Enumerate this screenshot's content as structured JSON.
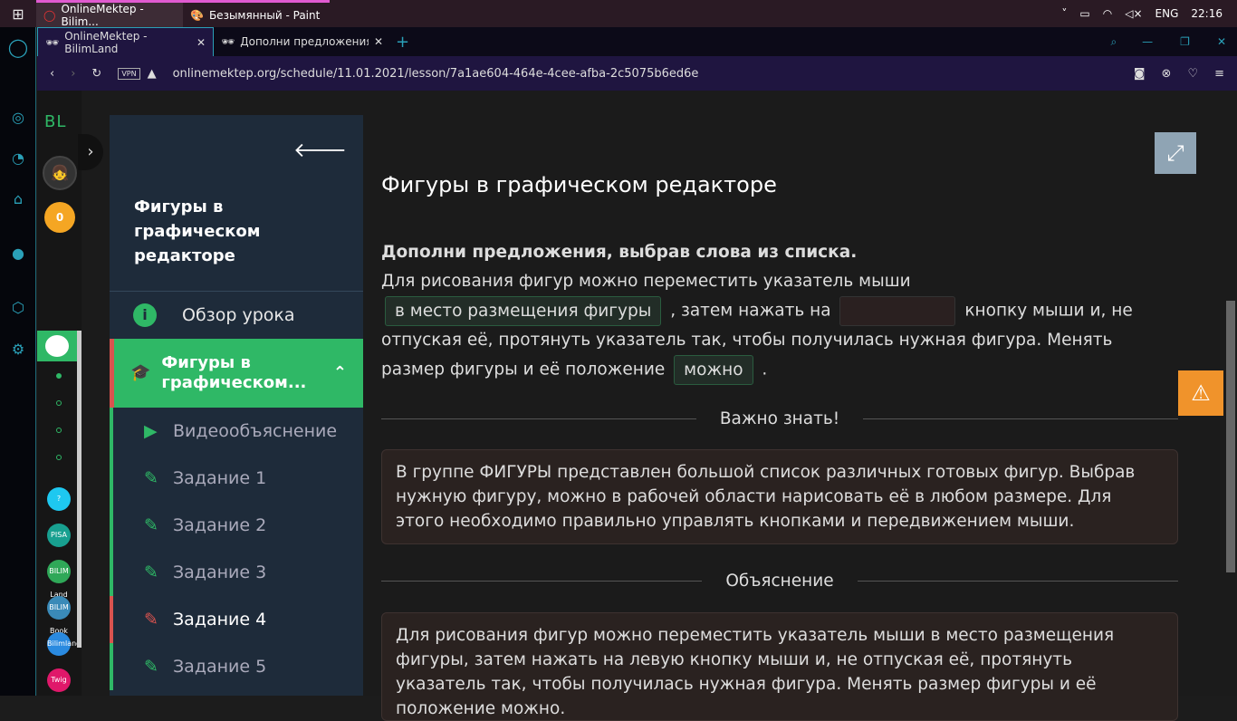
{
  "taskbar": {
    "apps": [
      "OnlineMektep - Bilim...",
      "Безымянный - Paint"
    ],
    "lang": "ENG",
    "time": "22:16"
  },
  "browser": {
    "tabs": [
      "OnlineMektep - BilimLand",
      "Дополни предложения, вы"
    ],
    "vpn": "VPN",
    "url": "onlinemektep.org/schedule/11.01.2021/lesson/7a1ae604-464e-4cee-afba-2c5075b6ed6e"
  },
  "bl": {
    "logo": "BL",
    "coins": "0",
    "apps": [
      "?",
      "PISA",
      "BILIM Land",
      "BILIM Book",
      "Bilimland",
      "Twig"
    ]
  },
  "lesson": {
    "title": "Фигуры в графическом редакторе",
    "overview": "Обзор урока",
    "section": "Фигуры в графическом...",
    "items": [
      "Видеообъяснение",
      "Задание 1",
      "Задание 2",
      "Задание 3",
      "Задание 4",
      "Задание 5"
    ]
  },
  "content": {
    "heading": "Фигуры в графическом редакторе",
    "instruction": "Дополни предложения, выбрав слова из списка.",
    "t1": "Для рисования фигур можно переместить указатель мыши",
    "b1": "в место размещения фигуры",
    "t2": ", затем нажать на",
    "b2": "",
    "t3": "кнопку мыши и, не отпуская её, протянуть указатель так, чтобы получилась нужная фигура. Менять размер фигуры и её положение",
    "b3": "можно",
    "t4": ".",
    "important_label": "Важно знать!",
    "important_text": "В группе ФИГУРЫ представлен большой список различных готовых фигур. Выбрав нужную фигуру, можно в рабочей области нарисовать её в любом размере. Для этого необходимо правильно управлять кнопками и передвижением мыши.",
    "explanation_label": "Объяснение",
    "explanation_text": "Для рисования фигур можно переместить указатель мыши в место размещения фигуры, затем нажать на левую кнопку мыши и, не отпуская её, протянуть указатель так, чтобы получилась нужная фигура. Менять размер фигуры и её положение можно."
  }
}
